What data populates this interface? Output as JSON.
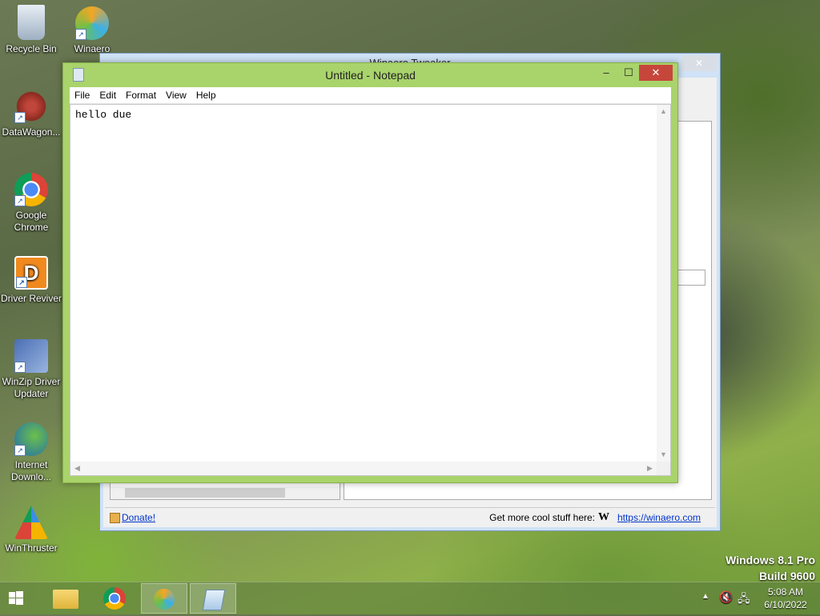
{
  "desktop": {
    "icons": [
      {
        "label": "Recycle Bin",
        "icon": "recycle-bin-icon"
      },
      {
        "label": "Winaero",
        "icon": "winaero-icon"
      },
      {
        "label": "DataWagon...",
        "icon": "datawagon-icon"
      },
      {
        "label": "Google Chrome",
        "icon": "chrome-icon"
      },
      {
        "label": "Driver Reviver",
        "icon": "driver-reviver-icon"
      },
      {
        "label": "WinZip Driver Updater",
        "icon": "winzip-icon"
      },
      {
        "label": "Internet Downlo...",
        "icon": "idm-icon"
      },
      {
        "label": "WinThruster",
        "icon": "winthruster-icon"
      }
    ],
    "watermark": {
      "line1": "Windows 8.1 Pro",
      "line2": "Build 9600"
    }
  },
  "background_window": {
    "title": "Winaero Tweaker",
    "close_label": "✕",
    "donate_label": "Donate!",
    "promo_text": "Get more cool stuff here:",
    "link_text": "https://winaero.com"
  },
  "notepad": {
    "title": "Untitled - Notepad",
    "menu": [
      "File",
      "Edit",
      "Format",
      "View",
      "Help"
    ],
    "content": "hello due",
    "controls": {
      "minimize": "–",
      "maximize": "☐",
      "close": "✕"
    }
  },
  "taskbar": {
    "time": "5:08 AM",
    "date": "6/10/2022",
    "items": [
      "start",
      "file-explorer",
      "chrome",
      "winaero-tweaker",
      "notepad"
    ]
  },
  "colors": {
    "notepad_frame": "#a9d36b",
    "close_button": "#c7463b",
    "link": "#0033cc"
  }
}
